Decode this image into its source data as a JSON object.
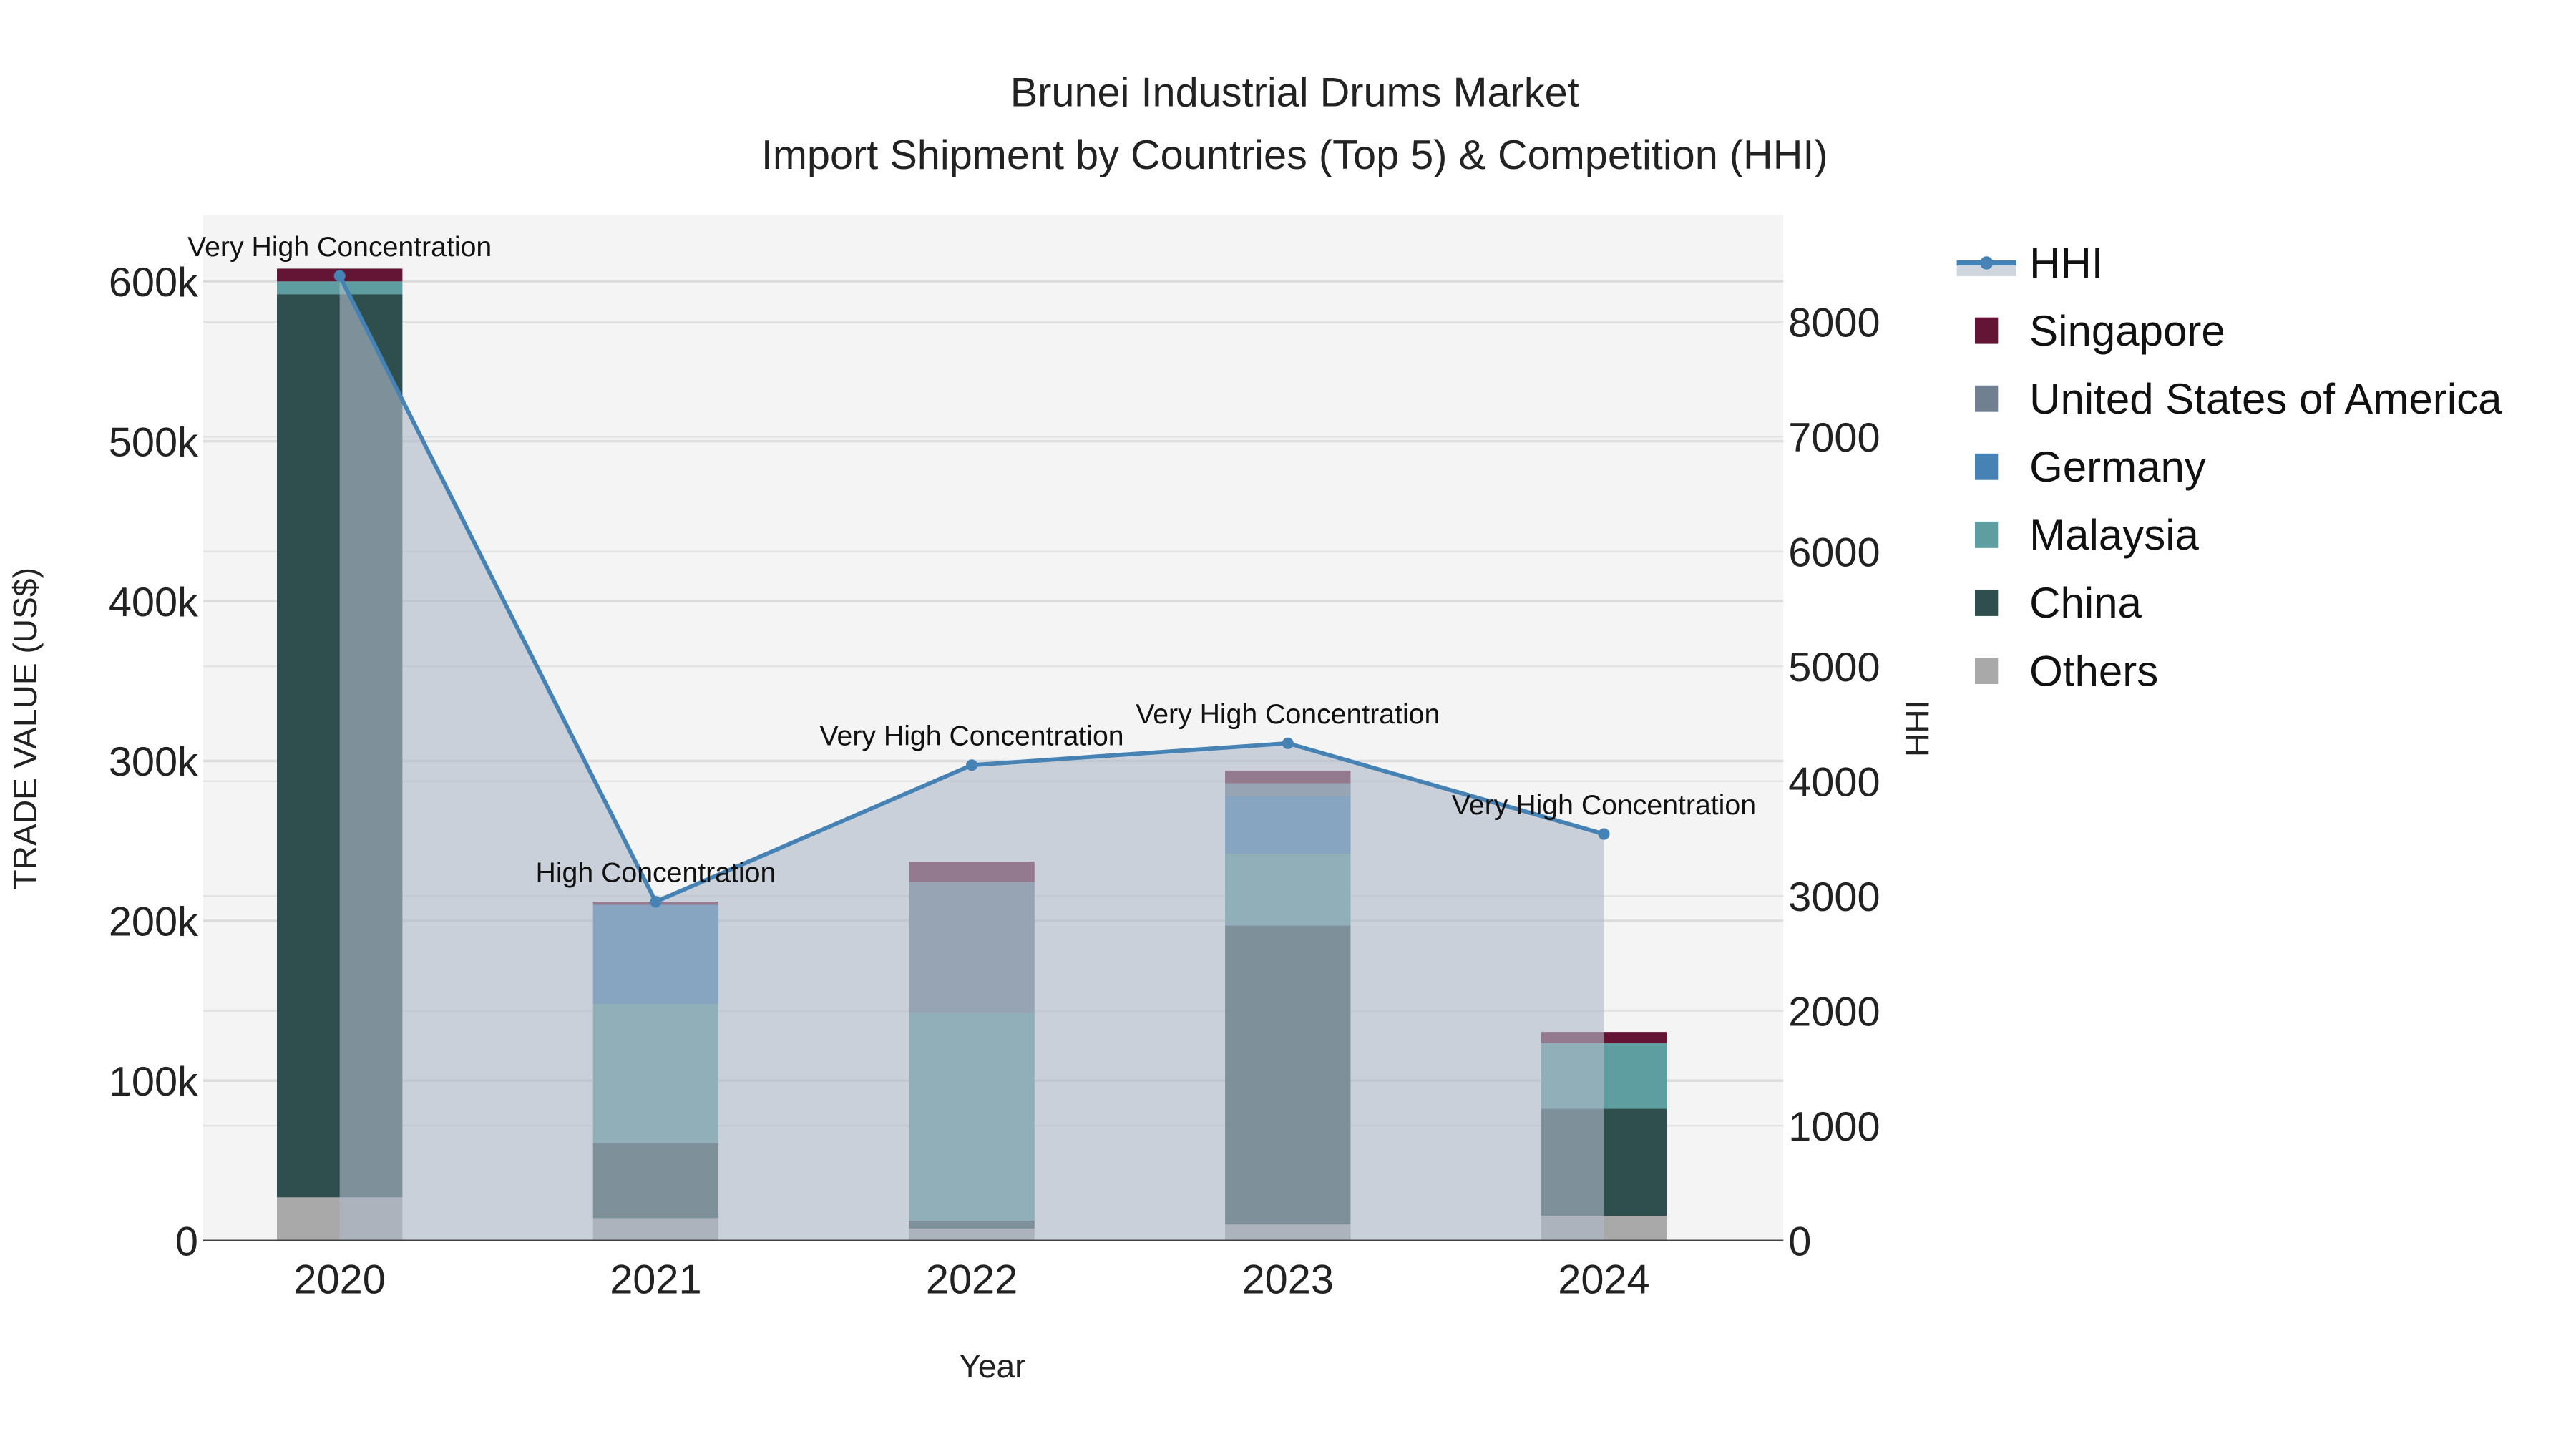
{
  "chart_data": {
    "type": "bar",
    "stacked": true,
    "title": "Brunei Industrial Drums Market",
    "subtitle": "Import Shipment by Countries (Top 5) & Competition (HHI)",
    "xlabel": "Year",
    "ylabel": "TRADE VALUE (US$)",
    "y2label": "HHI",
    "categories": [
      "2020",
      "2021",
      "2022",
      "2023",
      "2024"
    ],
    "ylim": [
      0,
      641500
    ],
    "y2lim": [
      0,
      8930
    ],
    "yticks": [
      0,
      100000,
      200000,
      300000,
      400000,
      500000,
      600000
    ],
    "ytick_labels": [
      "0",
      "100k",
      "200k",
      "300k",
      "400k",
      "500k",
      "600k"
    ],
    "y2ticks": [
      0,
      1000,
      2000,
      3000,
      4000,
      5000,
      6000,
      7000,
      8000
    ],
    "y2tick_labels": [
      "0",
      "1000",
      "2000",
      "3000",
      "4000",
      "5000",
      "6000",
      "7000",
      "8000"
    ],
    "grid": true,
    "legend_position": "right",
    "series": [
      {
        "name": "Others",
        "color": "#A9A9A9",
        "values": [
          27000,
          14000,
          7500,
          10000,
          15500
        ]
      },
      {
        "name": "China",
        "color": "#2F4F4F",
        "values": [
          565000,
          47000,
          5000,
          187000,
          67000
        ]
      },
      {
        "name": "Malaysia",
        "color": "#5F9EA0",
        "values": [
          8000,
          87000,
          130000,
          45000,
          41000
        ]
      },
      {
        "name": "Germany",
        "color": "#4682B4",
        "values": [
          0,
          62000,
          0,
          36000,
          0
        ]
      },
      {
        "name": "United States of America",
        "color": "#708090",
        "values": [
          0,
          0,
          82000,
          8000,
          0
        ]
      },
      {
        "name": "Singapore",
        "color": "#641434",
        "values": [
          8000,
          2000,
          12500,
          8000,
          7000
        ]
      }
    ],
    "hhi": {
      "name": "HHI",
      "color": "#4682B4",
      "values": [
        8400,
        2950,
        4140,
        4330,
        3540
      ],
      "labels": [
        "Very High Concentration",
        "High Concentration",
        "Very High Concentration",
        "Very High Concentration",
        "Very High Concentration"
      ]
    },
    "legend_order": [
      "HHI",
      "Singapore",
      "United States of America",
      "Germany",
      "Malaysia",
      "China",
      "Others"
    ]
  }
}
